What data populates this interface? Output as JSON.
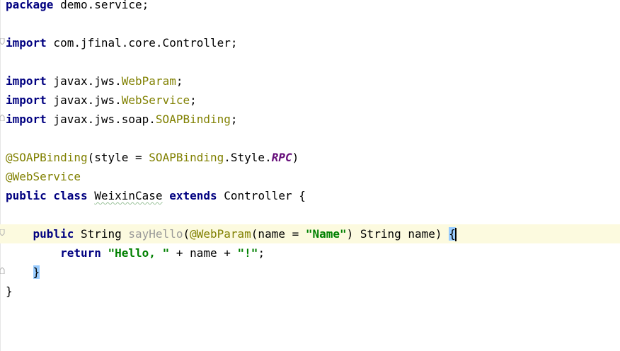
{
  "editor": {
    "lines": [
      {
        "id": "package",
        "parts": [
          {
            "t": "package",
            "c": "kw"
          },
          {
            "t": " demo.service;"
          }
        ]
      },
      {
        "id": "blank1",
        "parts": []
      },
      {
        "id": "import-controller",
        "parts": [
          {
            "t": "import",
            "c": "kw"
          },
          {
            "t": " com.jfinal.core.Controller;"
          }
        ]
      },
      {
        "id": "blank2",
        "parts": []
      },
      {
        "id": "import-webparam",
        "parts": [
          {
            "t": "import",
            "c": "kw"
          },
          {
            "t": " javax.jws."
          },
          {
            "t": "WebParam",
            "c": "ann"
          },
          {
            "t": ";"
          }
        ]
      },
      {
        "id": "import-webservice",
        "parts": [
          {
            "t": "import",
            "c": "kw"
          },
          {
            "t": " javax.jws."
          },
          {
            "t": "WebService",
            "c": "ann"
          },
          {
            "t": ";"
          }
        ]
      },
      {
        "id": "import-soapbinding",
        "parts": [
          {
            "t": "import",
            "c": "kw"
          },
          {
            "t": " javax.jws.soap."
          },
          {
            "t": "SOAPBinding",
            "c": "ann"
          },
          {
            "t": ";"
          }
        ]
      },
      {
        "id": "blank3",
        "parts": []
      },
      {
        "id": "annotation-soapbinding",
        "parts": [
          {
            "t": "@SOAPBinding",
            "c": "ann"
          },
          {
            "t": "(style = "
          },
          {
            "t": "SOAPBinding",
            "c": "ann"
          },
          {
            "t": ".Style."
          },
          {
            "t": "RPC",
            "c": "const"
          },
          {
            "t": ")"
          }
        ]
      },
      {
        "id": "annotation-webservice",
        "parts": [
          {
            "t": "@WebService",
            "c": "ann"
          }
        ]
      },
      {
        "id": "class-declaration",
        "parts": [
          {
            "t": "public class",
            "c": "kw"
          },
          {
            "t": " "
          },
          {
            "t": "WeixinCase",
            "c": "typo"
          },
          {
            "t": " "
          },
          {
            "t": "extends",
            "c": "kw"
          },
          {
            "t": " Controller {"
          }
        ]
      },
      {
        "id": "blank4",
        "parts": []
      },
      {
        "id": "method-declaration",
        "current": true,
        "parts": [
          {
            "t": "    "
          },
          {
            "t": "public",
            "c": "kw"
          },
          {
            "t": " String "
          },
          {
            "t": "sayHello",
            "c": "gray"
          },
          {
            "t": "("
          },
          {
            "t": "@WebParam",
            "c": "ann"
          },
          {
            "t": "(name = "
          },
          {
            "t": "\"Name\"",
            "c": "str"
          },
          {
            "t": ") String name) "
          },
          {
            "t": "{",
            "c": "brace-hl"
          }
        ]
      },
      {
        "id": "return-statement",
        "parts": [
          {
            "t": "        "
          },
          {
            "t": "return",
            "c": "kw"
          },
          {
            "t": " "
          },
          {
            "t": "\"Hello, \"",
            "c": "str"
          },
          {
            "t": " + name + "
          },
          {
            "t": "\"!\"",
            "c": "str"
          },
          {
            "t": ";"
          }
        ]
      },
      {
        "id": "method-close",
        "parts": [
          {
            "t": "    "
          },
          {
            "t": "}",
            "c": "brace-hl"
          }
        ]
      },
      {
        "id": "class-close",
        "parts": [
          {
            "t": "}"
          }
        ]
      }
    ]
  }
}
